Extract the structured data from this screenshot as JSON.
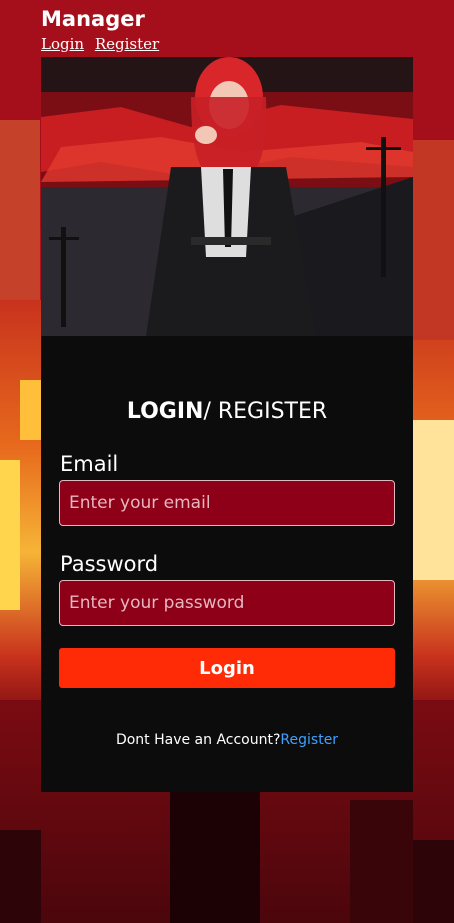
{
  "header": {
    "brand": "Manager",
    "nav": {
      "login": "Login",
      "register": "Register"
    }
  },
  "form": {
    "title_bold": "LOGIN",
    "title_rest": "/ REGISTER",
    "email": {
      "label": "Email",
      "placeholder": "Enter your email",
      "value": ""
    },
    "password": {
      "label": "Password",
      "placeholder": "Enter your password",
      "value": ""
    },
    "submit_label": "Login"
  },
  "footer": {
    "prompt": "Dont Have an Account?",
    "link": "Register"
  },
  "colors": {
    "page_bg": "#b1121a",
    "card_bg": "#0c0c0d",
    "input_bg": "#8d0017",
    "button_bg": "#ff2a06",
    "link": "#3fa2ff"
  },
  "icons": {
    "hero": "anime-character-illustration"
  }
}
